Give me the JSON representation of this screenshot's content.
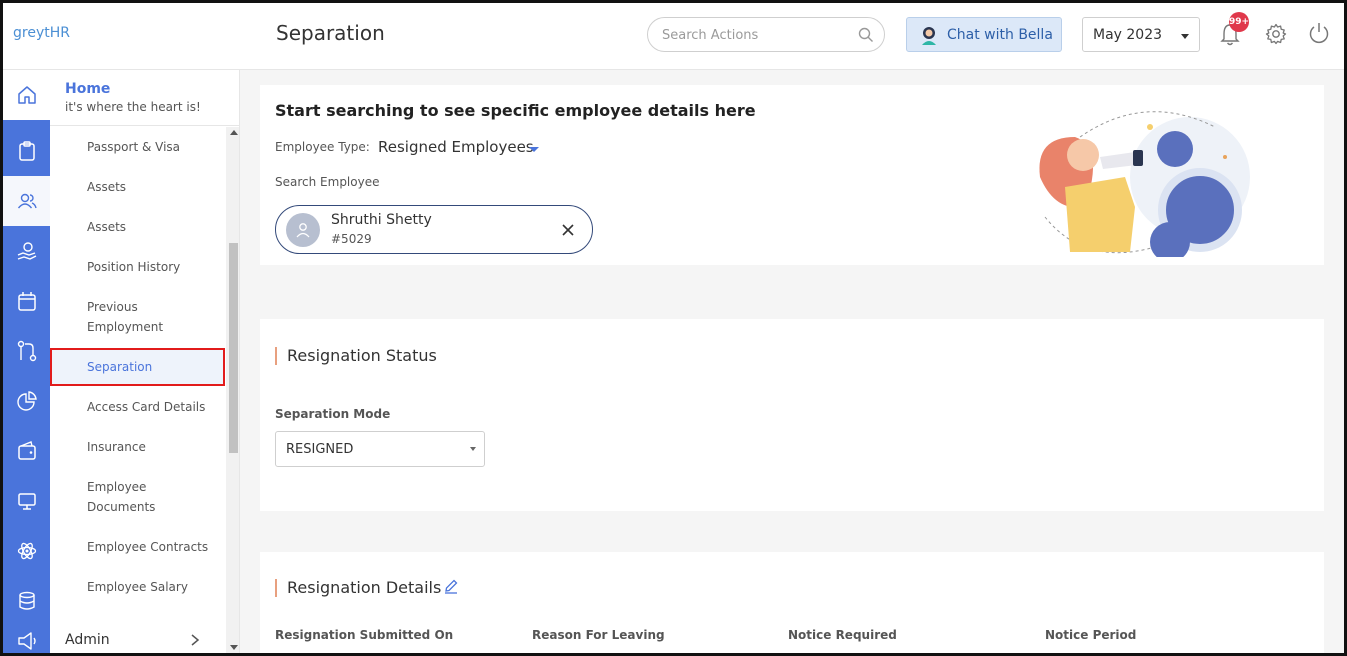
{
  "header": {
    "brand": "greytHR",
    "page_title": "Separation",
    "search_placeholder": "Search Actions",
    "chat_label": "Chat with Bella",
    "month_value": "May 2023",
    "notification_badge": "99+"
  },
  "sidebar_rail": {
    "items": [
      "home-icon",
      "clipboard-icon",
      "people-icon",
      "hand-coin-icon",
      "calendar-icon",
      "git-branch-icon",
      "pie-chart-icon",
      "wallet-icon",
      "monitor-icon",
      "atom-icon",
      "database-icon",
      "megaphone-icon"
    ],
    "selected": "people-icon",
    "accent_color": "#4a74db"
  },
  "subnav": {
    "home_title": "Home",
    "home_subtitle": "it's where the heart is!",
    "items": [
      "Passport & Visa",
      "Assets",
      "Assets",
      "Position History",
      "Previous Employment",
      "Separation",
      "Access Card Details",
      "Insurance",
      "Employee Documents",
      "Employee Contracts",
      "Employee Salary"
    ],
    "active_item": "Separation",
    "admin_label": "Admin"
  },
  "search_card": {
    "heading": "Start searching to see specific employee details here",
    "employee_type_label": "Employee Type:",
    "employee_type_value": "Resigned Employees",
    "search_employee_label": "Search Employee",
    "employee": {
      "name": "Shruthi Shetty",
      "id": "#5029"
    }
  },
  "resignation_status": {
    "title": "Resignation Status",
    "separation_mode_label": "Separation Mode",
    "separation_mode_value": "RESIGNED"
  },
  "resignation_details": {
    "title": "Resignation Details",
    "columns": [
      "Resignation Submitted On",
      "Reason For Leaving",
      "Notice Required",
      "Notice Period"
    ]
  }
}
